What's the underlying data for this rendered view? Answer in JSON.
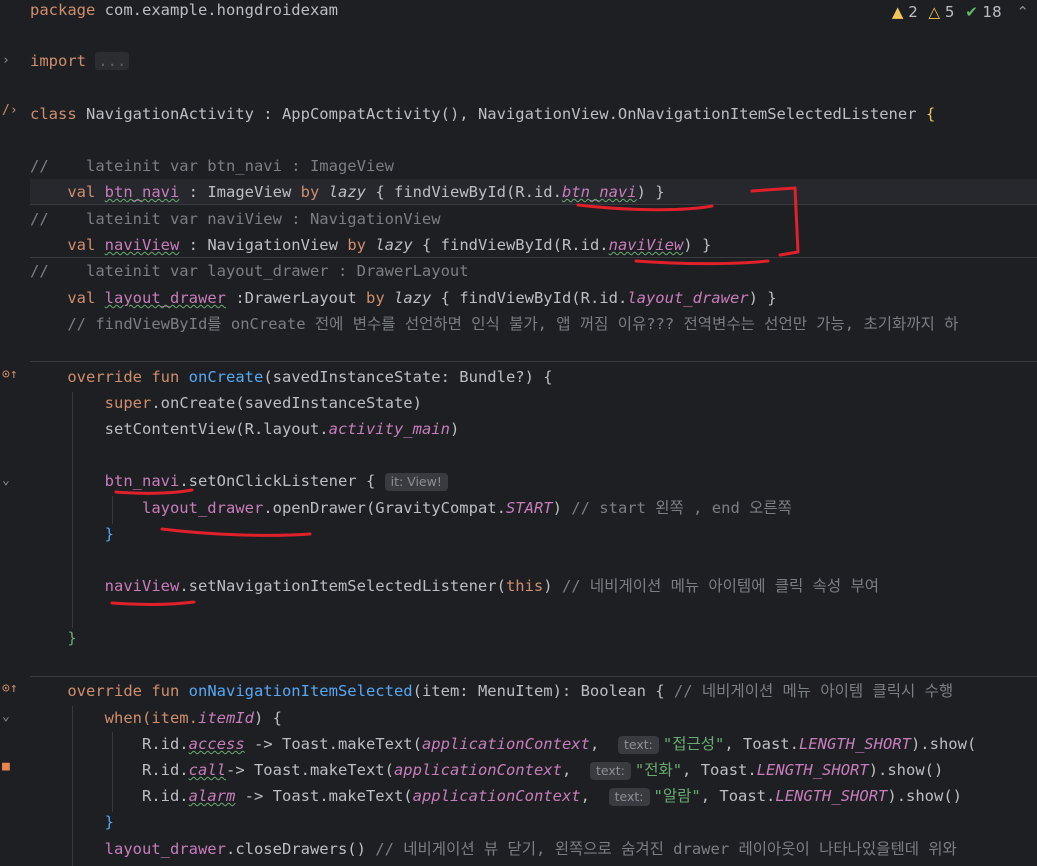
{
  "inspections": {
    "errors": "2",
    "warnings": "5",
    "weak": "18"
  },
  "code": {
    "l1_pkg": "package",
    "l1_name": " com.example.hongdroidexam",
    "l2_import": "import",
    "l2_fold": "...",
    "l3_class": "class",
    "l3_rest": " NavigationActivity : AppCompatActivity(), NavigationView.OnNavigationItemSelectedListener ",
    "l3_brace": "{",
    "l4_comment": "//    lateinit var btn_navi : ImageView",
    "l5_val": "val",
    "l5_name": "btn_navi",
    "l5_type": " : ImageView ",
    "l5_by": "by",
    "l5_lazy": "lazy",
    "l5_mid": " { findViewById(R.id.",
    "l5_id": "btn_navi",
    "l5_end": ") }",
    "l6_comment": "//    lateinit var naviView : NavigationView",
    "l7_val": "val",
    "l7_name": "naviView",
    "l7_type": " : NavigationView ",
    "l7_by": "by",
    "l7_lazy": "lazy",
    "l7_mid": " { findViewById(R.id.",
    "l7_id": "naviView",
    "l7_end": ") }",
    "l8_comment": "//    lateinit var layout_drawer : DrawerLayout",
    "l9_val": "val",
    "l9_name": "layout_drawer",
    "l9_type": " :DrawerLayout ",
    "l9_by": "by",
    "l9_lazy": "lazy",
    "l9_mid": " { findViewById(R.id.",
    "l9_id": "layout_drawer",
    "l9_end": ") }",
    "l10_comment": "// findViewById를 onCreate 전에 변수를 선언하면 인식 불가, 앱 꺼짐 이유??? 전역변수는 선언만 가능, 초기화까지 하",
    "l11_kw": "override fun",
    "l11_fn": "onCreate",
    "l11_rest": "(savedInstanceState: Bundle?) {",
    "l12_super": "super",
    "l12_rest": ".onCreate(savedInstanceState)",
    "l13_a": "setContentView(R.layout.",
    "l13_id": "activity_main",
    "l13_b": ")",
    "l14_name": "btn_navi",
    "l14_rest": ".setOnClickListener {",
    "l14_hint": "it: View!",
    "l15_name": "layout_drawer",
    "l15_a": ".openDrawer(GravityCompat.",
    "l15_start": "START",
    "l15_b": ") ",
    "l15_comment": "// start 왼쪽 , end 오른쪽",
    "l16_brace": "}",
    "l17_name": "naviView",
    "l17_a": ".setNavigationItemSelectedListener(",
    "l17_this": "this",
    "l17_b": ") ",
    "l17_comment": "// 네비게이션 메뉴 아이템에 클릭 속성 부여",
    "l18_brace": "}",
    "l19_kw": "override fun",
    "l19_fn": "onNavigationItemSelected",
    "l19_rest": "(item: MenuItem): Boolean { ",
    "l19_comment": "// 네비게이션 메뉴 아이템 클릭시 수행",
    "l20_a": "when(item.",
    "l20_id": "itemId",
    "l20_b": ") {",
    "l21_a": "R.id.",
    "l21_id": "access",
    "l21_b": " -> Toast.makeText(",
    "l21_ctx": "applicationContext",
    "l21_c": ",",
    "l21_hint": "text:",
    "l21_str": "\"접근성\"",
    "l21_d": ", Toast.",
    "l21_len": "LENGTH_SHORT",
    "l21_e": ").show(",
    "l22_a": "R.id.",
    "l22_id": "call",
    "l22_b": "-> Toast.makeText(",
    "l22_ctx": "applicationContext",
    "l22_c": ",",
    "l22_hint": "text:",
    "l22_str": "\"전화\"",
    "l22_d": ", Toast.",
    "l22_len": "LENGTH_SHORT",
    "l22_e": ").show()",
    "l23_a": "R.id.",
    "l23_id": "alarm",
    "l23_b": " -> Toast.makeText(",
    "l23_ctx": "applicationContext",
    "l23_c": ",",
    "l23_hint": "text:",
    "l23_str": "\"알람\"",
    "l23_d": ", Toast.",
    "l23_len": "LENGTH_SHORT",
    "l23_e": ").show()",
    "l24_brace": "}",
    "l25_name": "layout_drawer",
    "l25_rest": ".closeDrawers() ",
    "l25_comment": "// 네비게이션 뷰 닫기, 왼쪽으로 숨겨진 drawer 레이아웃이 나타나있을텐데 위와"
  },
  "colors": {
    "background": "#1e1f22",
    "keyword": "#cf8e6d",
    "function": "#56a8f5",
    "property": "#c77dbb",
    "comment": "#7a7e85",
    "string": "#6aab73",
    "annotation_mark": "#e0202a"
  }
}
